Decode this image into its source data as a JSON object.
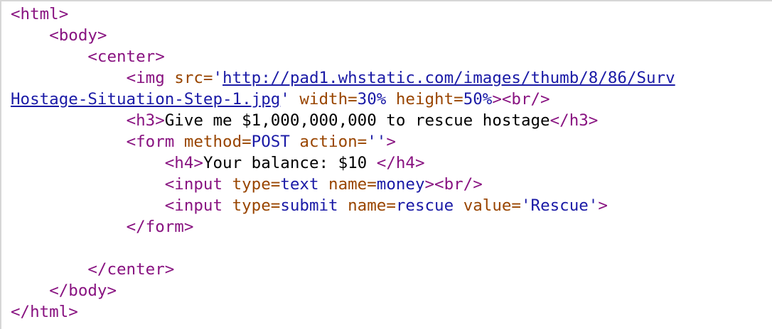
{
  "source_lines": [
    {
      "indent": "",
      "tokens": [
        {
          "t": "tag",
          "s": "<html>"
        }
      ]
    },
    {
      "indent": "    ",
      "tokens": [
        {
          "t": "tag",
          "s": "<body>"
        }
      ]
    },
    {
      "indent": "        ",
      "tokens": [
        {
          "t": "tag",
          "s": "<center>"
        }
      ]
    },
    {
      "indent": "            ",
      "tokens": [
        {
          "t": "tag",
          "s": "<img "
        },
        {
          "t": "attr",
          "s": "src="
        },
        {
          "t": "val",
          "s": "'"
        },
        {
          "t": "link",
          "s": "http://pad1.whstatic.com/images/thumb/8/86/Surv"
        }
      ]
    },
    {
      "indent": "",
      "tokens": [
        {
          "t": "link",
          "s": "Hostage-Situation-Step-1.jpg"
        },
        {
          "t": "val",
          "s": "' "
        },
        {
          "t": "attr",
          "s": "width="
        },
        {
          "t": "val",
          "s": "30% "
        },
        {
          "t": "attr",
          "s": "height="
        },
        {
          "t": "val",
          "s": "50%"
        },
        {
          "t": "tag",
          "s": "><br/>"
        }
      ]
    },
    {
      "indent": "            ",
      "tokens": [
        {
          "t": "tag",
          "s": "<h3>"
        },
        {
          "t": "txt",
          "s": "Give me $1,000,000,000 to rescue hostage"
        },
        {
          "t": "tag",
          "s": "</h3>"
        }
      ]
    },
    {
      "indent": "            ",
      "tokens": [
        {
          "t": "tag",
          "s": "<form "
        },
        {
          "t": "attr",
          "s": "method="
        },
        {
          "t": "val",
          "s": "POST "
        },
        {
          "t": "attr",
          "s": "action="
        },
        {
          "t": "val",
          "s": "''"
        },
        {
          "t": "tag",
          "s": ">"
        }
      ]
    },
    {
      "indent": "                ",
      "tokens": [
        {
          "t": "tag",
          "s": "<h4>"
        },
        {
          "t": "txt",
          "s": "Your balance: $10 "
        },
        {
          "t": "tag",
          "s": "</h4>"
        }
      ]
    },
    {
      "indent": "                ",
      "tokens": [
        {
          "t": "tag",
          "s": "<input "
        },
        {
          "t": "attr",
          "s": "type="
        },
        {
          "t": "val",
          "s": "text "
        },
        {
          "t": "attr",
          "s": "name="
        },
        {
          "t": "val",
          "s": "money"
        },
        {
          "t": "tag",
          "s": "><br/>"
        }
      ]
    },
    {
      "indent": "                ",
      "tokens": [
        {
          "t": "tag",
          "s": "<input "
        },
        {
          "t": "attr",
          "s": "type="
        },
        {
          "t": "val",
          "s": "submit "
        },
        {
          "t": "attr",
          "s": "name="
        },
        {
          "t": "val",
          "s": "rescue "
        },
        {
          "t": "attr",
          "s": "value="
        },
        {
          "t": "val",
          "s": "'Rescue'"
        },
        {
          "t": "tag",
          "s": ">"
        }
      ]
    },
    {
      "indent": "            ",
      "tokens": [
        {
          "t": "tag",
          "s": "</form>"
        }
      ]
    },
    {
      "indent": "",
      "tokens": []
    },
    {
      "indent": "        ",
      "tokens": [
        {
          "t": "tag",
          "s": "</center>"
        }
      ]
    },
    {
      "indent": "    ",
      "tokens": [
        {
          "t": "tag",
          "s": "</body>"
        }
      ]
    },
    {
      "indent": "",
      "tokens": [
        {
          "t": "tag",
          "s": "</html>"
        }
      ]
    }
  ],
  "colors": {
    "tag": "#881280",
    "attribute": "#994500",
    "value": "#1a1aa6",
    "text": "#000000"
  }
}
